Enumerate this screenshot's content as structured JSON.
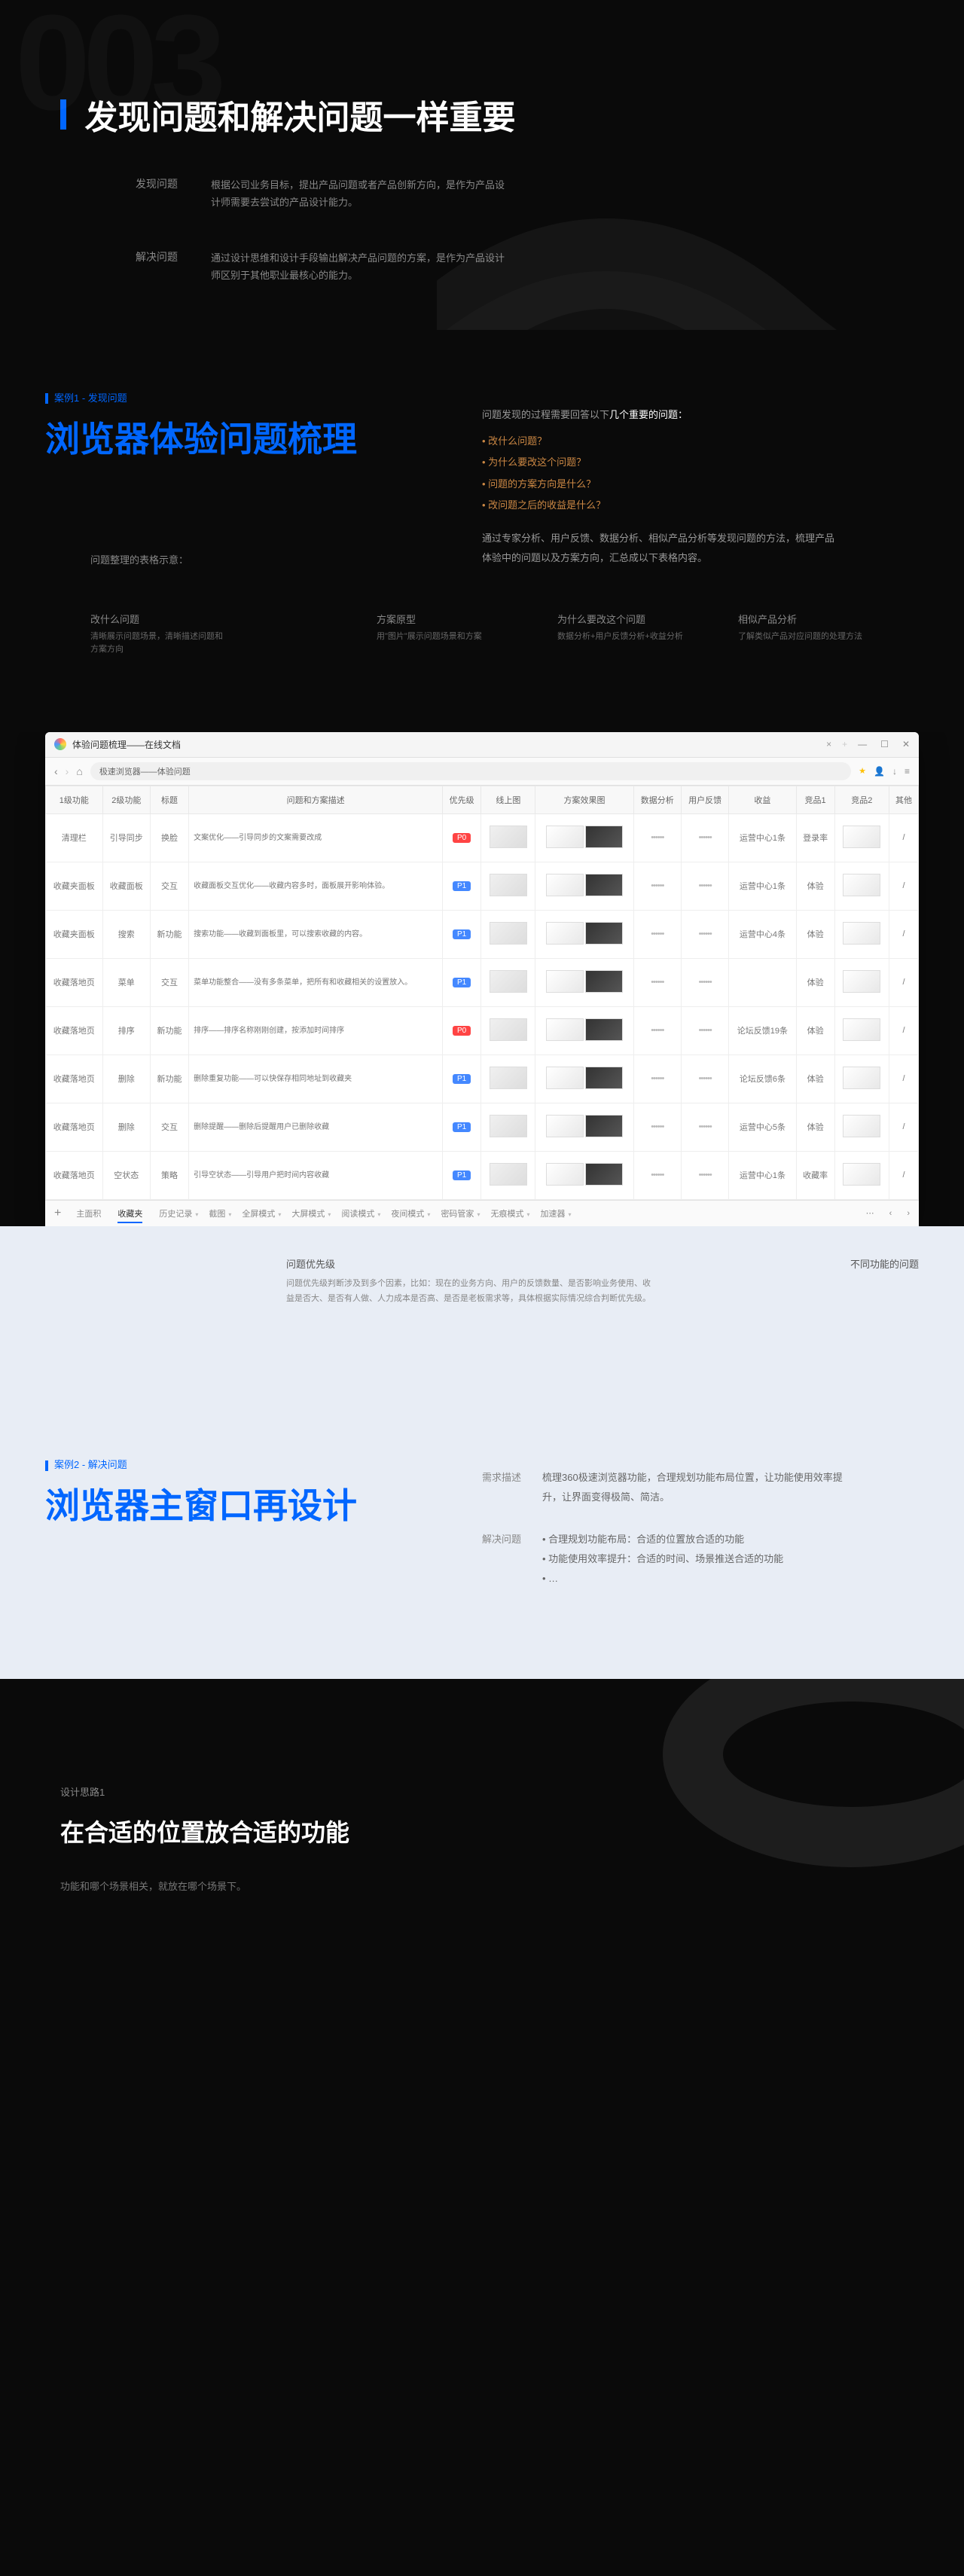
{
  "hero": {
    "number": "003",
    "title": "发现问题和解决问题一样重要",
    "rows": [
      {
        "label": "发现问题",
        "text": "根据公司业务目标，提出产品问题或者产品创新方向，是作为产品设计师需要去尝试的产品设计能力。"
      },
      {
        "label": "解决问题",
        "text": "通过设计思维和设计手段输出解决产品问题的方案，是作为产品设计师区别于其他职业最核心的能力。"
      }
    ]
  },
  "case1": {
    "tag": "案例1 - 发现问题",
    "title": "浏览器体验问题梳理",
    "intro": "问题发现的过程需要回答以下",
    "intro_highlight": "几个重要的问题：",
    "bullets": [
      "改什么问题？",
      "为什么要改这个问题？",
      "问题的方案方向是什么？",
      "改问题之后的收益是什么？"
    ],
    "summary": "通过专家分析、用户反馈、数据分析、相似产品分析等发现问题的方法，梳理产品体验中的问题以及方案方向，汇总成以下表格内容。",
    "table_intro": "问题整理的表格示意：",
    "annotations": [
      {
        "title": "改什么问题",
        "sub": "清晰展示问题场景，清晰描述问题和方案方向"
      },
      {
        "title": "方案原型",
        "sub": "用\"图片\"展示问题场景和方案"
      },
      {
        "title": "为什么要改这个问题",
        "sub": "数据分析+用户反馈分析+收益分析"
      },
      {
        "title": "相似产品分析",
        "sub": "了解类似产品对应问题的处理方法"
      }
    ]
  },
  "browser": {
    "tab_title": "体验问题梳理——在线文档",
    "address": "极速浏览器——体验问题",
    "headers": [
      "1级功能",
      "2级功能",
      "标题",
      "问题和方案描述",
      "优先级",
      "线上图",
      "方案效果图",
      "数据分析",
      "用户反馈",
      "收益",
      "竞品1",
      "竞品2",
      "其他"
    ],
    "rows": [
      {
        "f1": "清理栏",
        "f2": "引导同步",
        "tag": "换脸",
        "desc": "文案优化——引导同步的文案需要改成",
        "prio": "P0",
        "dots": "••••••",
        "fb": "••••••",
        "gain1": "运营中心1条",
        "gain2": "登录率"
      },
      {
        "f1": "收藏夹面板",
        "f2": "收藏面板",
        "tag": "交互",
        "desc": "收藏面板交互优化——收藏内容多时，面板展开影响体验。",
        "prio": "P1",
        "dots": "••••••",
        "fb": "••••••",
        "gain1": "运营中心1条",
        "gain2": "体验"
      },
      {
        "f1": "收藏夹面板",
        "f2": "搜索",
        "tag": "新功能",
        "desc": "搜索功能——收藏到面板里，可以搜索收藏的内容。",
        "prio": "P1",
        "dots": "••••••",
        "fb": "••••••",
        "gain1": "运营中心4条",
        "gain2": "体验"
      },
      {
        "f1": "收藏落地页",
        "f2": "菜单",
        "tag": "交互",
        "desc": "菜单功能整合——没有多条菜单，把所有和收藏相关的设置放入。",
        "prio": "P1",
        "dots": "••••••",
        "fb": "••••••",
        "gain1": "",
        "gain2": "体验"
      },
      {
        "f1": "收藏落地页",
        "f2": "排序",
        "tag": "新功能",
        "desc": "排序——排序名称刚刚创建，按添加时间排序",
        "prio": "P0",
        "dots": "••••••",
        "fb": "••••••",
        "gain1": "论坛反馈19条",
        "gain2": "体验"
      },
      {
        "f1": "收藏落地页",
        "f2": "删除",
        "tag": "新功能",
        "desc": "删除重复功能——可以快保存相同地址到收藏夹",
        "prio": "P1",
        "dots": "••••••",
        "fb": "••••••",
        "gain1": "论坛反馈6条",
        "gain2": "体验"
      },
      {
        "f1": "收藏落地页",
        "f2": "删除",
        "tag": "交互",
        "desc": "删除提醒——删除后提醒用户已删除收藏",
        "prio": "P1",
        "dots": "••••••",
        "fb": "••••••",
        "gain1": "运营中心5条",
        "gain2": "体验"
      },
      {
        "f1": "收藏落地页",
        "f2": "空状态",
        "tag": "策略",
        "desc": "引导空状态——引导用户把时间内容收藏",
        "prio": "P1",
        "dots": "••••••",
        "fb": "••••••",
        "gain1": "运营中心1条",
        "gain2": "收藏率"
      }
    ],
    "bottom_tabs": [
      "主面积",
      "收藏夹",
      "历史记录",
      "截图",
      "全屏模式",
      "大屏模式",
      "阅读模式",
      "夜间模式",
      "密码管家",
      "无痕模式",
      "加速器"
    ],
    "active_tab_idx": 1
  },
  "below": {
    "left_title": "问题优先级",
    "left_text": "问题优先级判断涉及到多个因素，比如：现在的业务方向、用户的反馈数量、是否影响业务使用、收益是否大、是否有人做、人力成本是否高、是否是老板需求等，具体根据实际情况综合判断优先级。",
    "right_title": "不同功能的问题"
  },
  "case2": {
    "tag": "案例2 - 解决问题",
    "title": "浏览器主窗口再设计",
    "desc_label": "需求描述",
    "desc_text": "梳理360极速浏览器功能，合理规划功能布局位置，让功能使用效率提升，让界面变得极简、简洁。",
    "solve_label": "解决问题",
    "solve_items": [
      "合理规划功能布局：合适的位置放合适的功能",
      "功能使用效率提升：合适的时间、场景推送合适的功能",
      "…"
    ]
  },
  "footer": {
    "tag": "设计思路1",
    "title": "在合适的位置放合适的功能",
    "sub": "功能和哪个场景相关，就放在哪个场景下。"
  }
}
